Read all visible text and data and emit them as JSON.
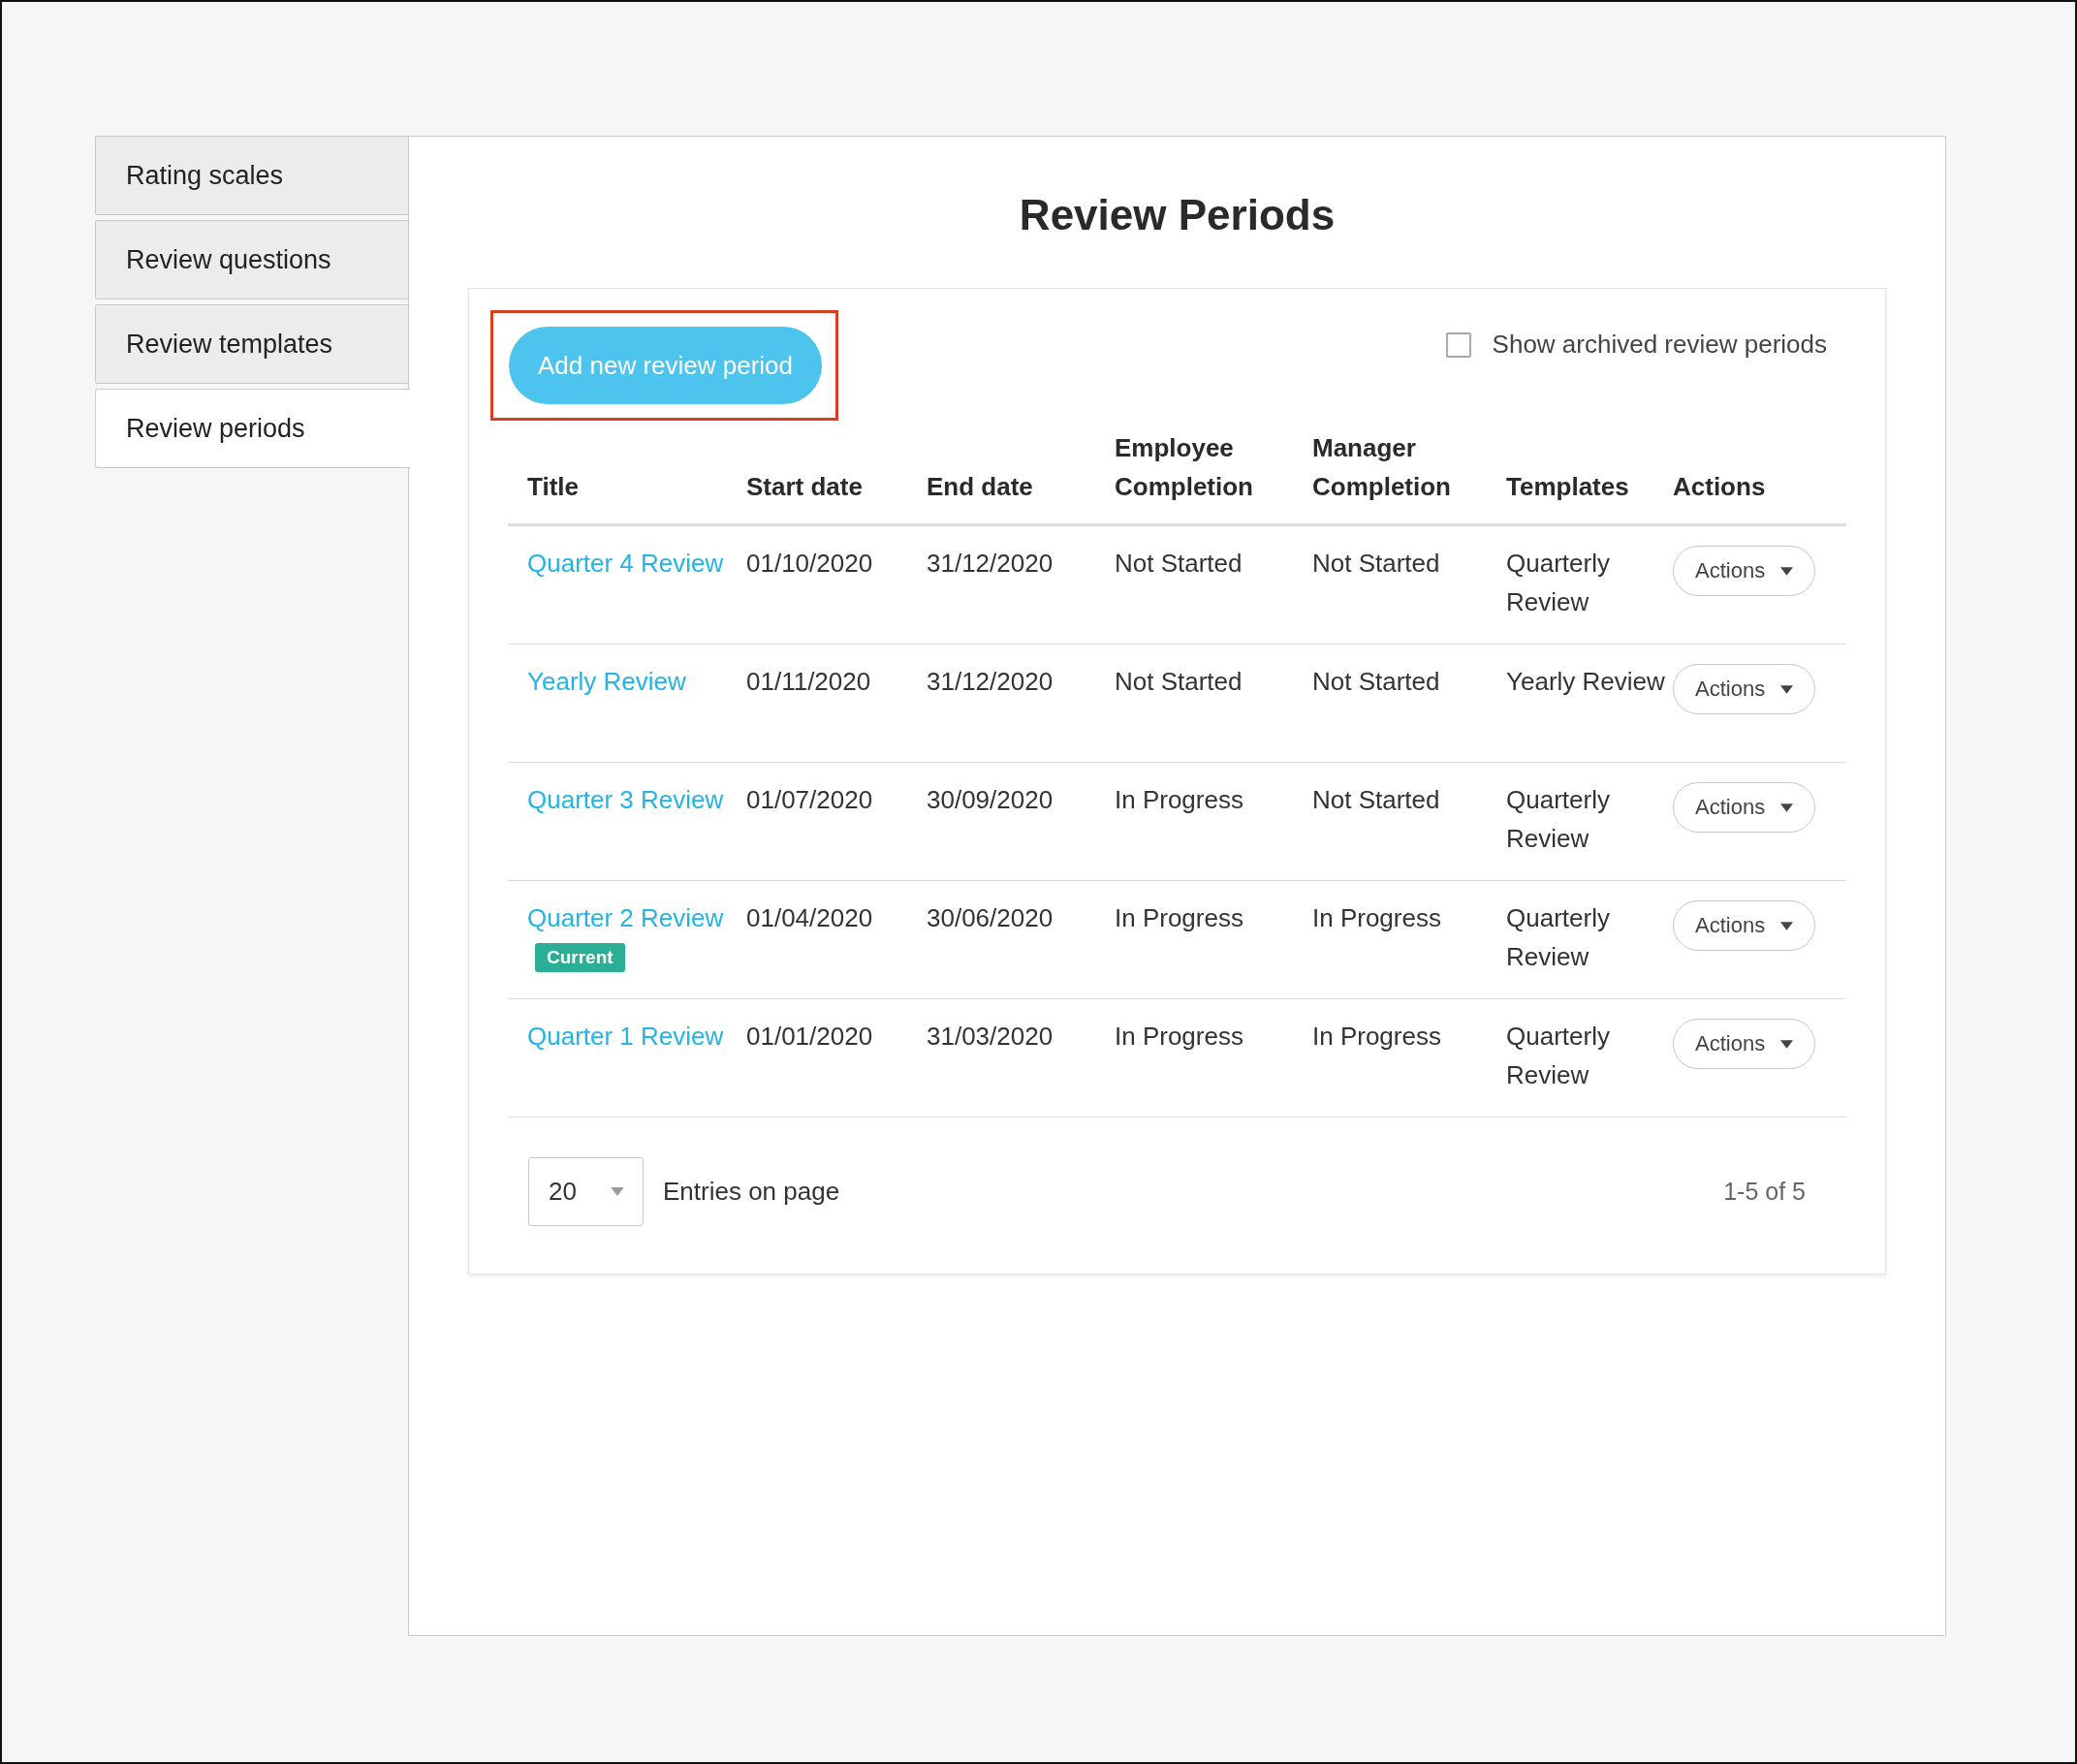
{
  "sidebar": {
    "items": [
      {
        "label": "Rating scales",
        "selected": false
      },
      {
        "label": "Review questions",
        "selected": false
      },
      {
        "label": "Review templates",
        "selected": false
      },
      {
        "label": "Review periods",
        "selected": true
      }
    ]
  },
  "page": {
    "title": "Review Periods"
  },
  "toolbar": {
    "add_button": {
      "label": "Add new review period",
      "highlighted": true
    },
    "show_archived": {
      "label": "Show archived review periods",
      "checked": false
    }
  },
  "table": {
    "columns": [
      "Title",
      "Start date",
      "End date",
      "Employee Completion",
      "Manager Completion",
      "Templates",
      "Actions"
    ],
    "rows": [
      {
        "title": "Quarter 4 Review",
        "start": "01/10/2020",
        "end": "31/12/2020",
        "employee": "Not Started",
        "manager": "Not Started",
        "template": "Quarterly Review",
        "action": "Actions"
      },
      {
        "title": "Yearly Review",
        "start": "01/11/2020",
        "end": "31/12/2020",
        "employee": "Not Started",
        "manager": "Not Started",
        "template": "Yearly Review",
        "action": "Actions"
      },
      {
        "title": "Quarter 3 Review",
        "start": "01/07/2020",
        "end": "30/09/2020",
        "employee": "In Progress",
        "manager": "Not Started",
        "template": "Quarterly Review",
        "action": "Actions"
      },
      {
        "title": "Quarter 2 Review",
        "badge": "Current",
        "start": "01/04/2020",
        "end": "30/06/2020",
        "employee": "In Progress",
        "manager": "In Progress",
        "template": "Quarterly Review",
        "action": "Actions"
      },
      {
        "title": "Quarter 1 Review",
        "start": "01/01/2020",
        "end": "31/03/2020",
        "employee": "In Progress",
        "manager": "In Progress",
        "template": "Quarterly Review",
        "action": "Actions"
      }
    ]
  },
  "pagination": {
    "page_size": "20",
    "label": "Entries on page",
    "range": "1-5 of 5"
  }
}
